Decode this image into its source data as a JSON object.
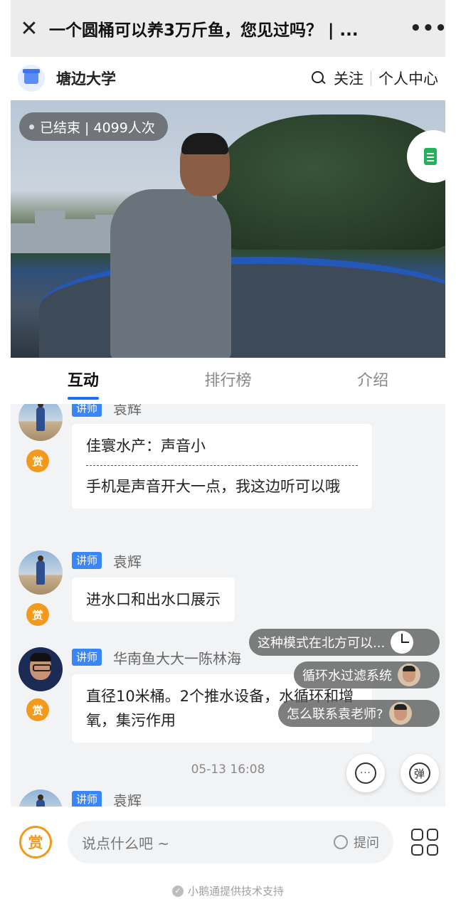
{
  "titlebar": {
    "close_icon": "close-icon",
    "title": "一个圆桶可以养3万斤鱼，您见过吗？ | ...",
    "more_icon": "more-icon"
  },
  "header": {
    "brand": "塘边大学",
    "follow": "关注",
    "profile": "个人中心"
  },
  "video": {
    "status": "已结束 | 4099人次"
  },
  "tabs": [
    {
      "label": "互动",
      "active": true
    },
    {
      "label": "排行榜",
      "active": false
    },
    {
      "label": "介绍",
      "active": false
    }
  ],
  "messages": [
    {
      "role": "讲师",
      "sender": "袁辉",
      "reward": "赏",
      "quote": "佳寰水产：声音小",
      "text": "手机是声音开大一点，我这边听可以哦"
    },
    {
      "role": "讲师",
      "sender": "袁辉",
      "reward": "赏",
      "text": "进水口和出水口展示"
    },
    {
      "role": "讲师",
      "sender": "华南鱼大大一陈林海",
      "reward": "赏",
      "text": "直径10米桶。2个推水设备，水循环和增氧，集污作用"
    },
    {
      "role": "讲师",
      "sender": "袁辉"
    }
  ],
  "timestamp": "05-13 16:08",
  "danmaku": [
    {
      "text": "这种模式在北方可以..."
    },
    {
      "text": "循环水过滤系统"
    },
    {
      "text": "怎么联系袁老师?"
    }
  ],
  "float_buttons": {
    "more": "···",
    "danmu": "弹"
  },
  "bottom": {
    "reward": "赏",
    "placeholder": "说点什么吧 ~",
    "ask": "提问"
  },
  "footer": "小鹅通提供技术支持"
}
